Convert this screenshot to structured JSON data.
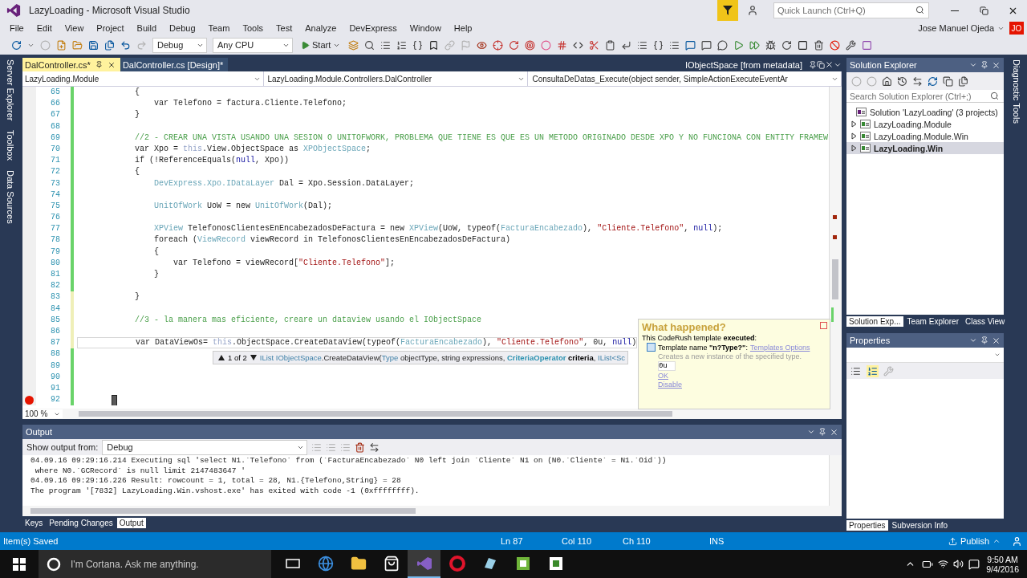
{
  "window": {
    "title": "LazyLoading - Microsoft Visual Studio",
    "quick_launch": {
      "placeholder": "Quick Launch (Ctrl+Q)"
    }
  },
  "menu": [
    "File",
    "Edit",
    "View",
    "Project",
    "Build",
    "Debug",
    "Team",
    "Tools",
    "Test",
    "Analyze",
    "DevExpress",
    "Window",
    "Help"
  ],
  "user": {
    "name": "Jose Manuel Ojeda",
    "initials": "JO"
  },
  "toolbar": {
    "configuration": "Debug",
    "platform": "Any CPU",
    "start": "Start"
  },
  "side_tabs_left": [
    "Server Explorer",
    "Toolbox",
    "Data Sources"
  ],
  "side_tabs_right": [
    "Diagnostic Tools"
  ],
  "editor": {
    "tabs": [
      {
        "label": "DalController.cs*",
        "selected": true
      },
      {
        "label": "DalController.cs [Design]*",
        "selected": false
      }
    ],
    "preview_tab": "IObjectSpace [from metadata]",
    "nav": [
      "LazyLoading.Module",
      "LazyLoading.Module.Controllers.DalController",
      "ConsultaDeDatas_Execute(object sender, SimpleActionExecuteEventAr"
    ],
    "lines": [
      {
        "number": "65",
        "saved": true,
        "breakpoint": false,
        "current": false,
        "marker": false,
        "segments": [
          {
            "text": "            {",
            "kind": "plain"
          }
        ]
      },
      {
        "number": "66",
        "saved": true,
        "breakpoint": false,
        "current": false,
        "marker": false,
        "segments": [
          {
            "text": "                var Telefono = factura.Cliente.Telefono;",
            "kind": "plain"
          }
        ]
      },
      {
        "number": "67",
        "saved": true,
        "breakpoint": false,
        "current": false,
        "marker": false,
        "segments": [
          {
            "text": "            }",
            "kind": "plain"
          }
        ]
      },
      {
        "number": "68",
        "saved": true,
        "breakpoint": false,
        "current": false,
        "marker": false
      },
      {
        "number": "69",
        "saved": true,
        "breakpoint": false,
        "current": false,
        "marker": false,
        "segments": [
          {
            "text": "            //2 - CREAR UNA VISTA USANDO UNA SESION O UNITOFWORK, PROBLEMA QUE TIENE ES QUE ES UN METODO ORIGINADO DESDE XPO Y NO FUNCIONA CON ENTITY FRAMEW",
            "kind": "comment"
          }
        ]
      },
      {
        "number": "70",
        "saved": true,
        "breakpoint": false,
        "current": false,
        "marker": false,
        "segments": [
          {
            "text": "            var Xpo = ",
            "kind": "plain"
          },
          {
            "text": "this",
            "kind": "this"
          },
          {
            "text": ".View.ObjectSpace as ",
            "kind": "plain"
          },
          {
            "text": "XPObjectSpace",
            "kind": "type"
          },
          {
            "text": ";",
            "kind": "plain"
          }
        ]
      },
      {
        "number": "71",
        "saved": true,
        "breakpoint": false,
        "current": false,
        "marker": false,
        "segments": [
          {
            "text": "            if (!ReferenceEquals(",
            "kind": "plain"
          },
          {
            "text": "null",
            "kind": "keyword"
          },
          {
            "text": ", Xpo))",
            "kind": "plain"
          }
        ]
      },
      {
        "number": "72",
        "saved": true,
        "breakpoint": false,
        "current": false,
        "marker": false,
        "segments": [
          {
            "text": "            {",
            "kind": "plain"
          }
        ]
      },
      {
        "number": "73",
        "saved": true,
        "breakpoint": false,
        "current": false,
        "marker": false,
        "segments": [
          {
            "text": "                DevExpress.Xpo.IDataLayer",
            "kind": "type"
          },
          {
            "text": " Dal = Xpo.Session.DataLayer;",
            "kind": "plain"
          }
        ]
      },
      {
        "number": "74",
        "saved": true,
        "breakpoint": false,
        "current": false,
        "marker": false
      },
      {
        "number": "75",
        "saved": true,
        "breakpoint": false,
        "current": false,
        "marker": false,
        "segments": [
          {
            "text": "                UnitOfWork",
            "kind": "type"
          },
          {
            "text": " UoW = new ",
            "kind": "plain"
          },
          {
            "text": "UnitOfWork",
            "kind": "type"
          },
          {
            "text": "(Dal);",
            "kind": "plain"
          }
        ]
      },
      {
        "number": "76",
        "saved": true,
        "breakpoint": false,
        "current": false,
        "marker": false
      },
      {
        "number": "77",
        "saved": true,
        "breakpoint": false,
        "current": false,
        "marker": false,
        "segments": [
          {
            "text": "                XPView",
            "kind": "type"
          },
          {
            "text": " TelefonosClientesEnEncabezadosDeFactura = new ",
            "kind": "plain"
          },
          {
            "text": "XPView",
            "kind": "type"
          },
          {
            "text": "(UoW, typeof(",
            "kind": "plain"
          },
          {
            "text": "FacturaEncabezado",
            "kind": "type"
          },
          {
            "text": "), ",
            "kind": "plain"
          },
          {
            "text": "\"Cliente.Telefono\"",
            "kind": "string"
          },
          {
            "text": ", ",
            "kind": "plain"
          },
          {
            "text": "null",
            "kind": "keyword"
          },
          {
            "text": ");",
            "kind": "plain"
          }
        ]
      },
      {
        "number": "78",
        "saved": true,
        "breakpoint": false,
        "current": false,
        "marker": false,
        "segments": [
          {
            "text": "                foreach (",
            "kind": "plain"
          },
          {
            "text": "ViewRecord",
            "kind": "type"
          },
          {
            "text": " viewRecord in TelefonosClientesEnEncabezadosDeFactura)",
            "kind": "plain"
          }
        ]
      },
      {
        "number": "79",
        "saved": true,
        "breakpoint": false,
        "current": false,
        "marker": false,
        "segments": [
          {
            "text": "                {",
            "kind": "plain"
          }
        ]
      },
      {
        "number": "80",
        "saved": true,
        "breakpoint": false,
        "current": false,
        "marker": false,
        "segments": [
          {
            "text": "                    var Telefono = viewRecord[",
            "kind": "plain"
          },
          {
            "text": "\"Cliente.Telefono\"",
            "kind": "string"
          },
          {
            "text": "];",
            "kind": "plain"
          }
        ]
      },
      {
        "number": "81",
        "saved": true,
        "breakpoint": false,
        "current": false,
        "marker": false,
        "segments": [
          {
            "text": "                }",
            "kind": "plain"
          }
        ]
      },
      {
        "number": "82",
        "saved": true,
        "breakpoint": false,
        "current": false,
        "marker": false
      },
      {
        "number": "83",
        "saved": false,
        "breakpoint": false,
        "current": false,
        "marker": false,
        "segments": [
          {
            "text": "            }",
            "kind": "plain"
          }
        ]
      },
      {
        "number": "84",
        "saved": false,
        "breakpoint": false,
        "current": false,
        "marker": false
      },
      {
        "number": "85",
        "saved": false,
        "breakpoint": false,
        "current": false,
        "marker": false,
        "segments": [
          {
            "text": "            //3 - la manera mas eficiente, creare un dataview usando el IObjectSpace",
            "kind": "comment"
          }
        ]
      },
      {
        "number": "86",
        "saved": false,
        "breakpoint": false,
        "current": false,
        "marker": false
      },
      {
        "number": "87",
        "saved": false,
        "breakpoint": false,
        "current": true,
        "marker": false,
        "segments": [
          {
            "text": "            var DataViewOs= ",
            "kind": "plain"
          },
          {
            "text": "this",
            "kind": "this"
          },
          {
            "text": ".ObjectSpace.CreateDataView(typeof(",
            "kind": "plain"
          },
          {
            "text": "FacturaEncabezado",
            "kind": "type"
          },
          {
            "text": "), ",
            "kind": "plain"
          },
          {
            "text": "\"Cliente.Telefono\"",
            "kind": "string"
          },
          {
            "text": ", 0u, ",
            "kind": "plain"
          },
          {
            "text": "null",
            "kind": "keyword"
          },
          {
            "text": ")",
            "kind": "plain"
          }
        ]
      },
      {
        "number": "88",
        "saved": true,
        "breakpoint": false,
        "current": false,
        "marker": false
      },
      {
        "number": "89",
        "saved": true,
        "breakpoint": false,
        "current": false,
        "marker": false
      },
      {
        "number": "90",
        "saved": true,
        "breakpoint": false,
        "current": false,
        "marker": false
      },
      {
        "number": "91",
        "saved": true,
        "breakpoint": false,
        "current": false,
        "marker": false
      },
      {
        "number": "92",
        "saved": true,
        "breakpoint": true,
        "current": false,
        "marker": true
      }
    ],
    "parameter_hint": {
      "counter": "1 of 2",
      "segments": [
        {
          "text": "IList IObjectSpace",
          "kind": "type"
        },
        {
          "text": ".CreateDataView(",
          "kind": "plain"
        },
        {
          "text": "Type",
          "kind": "type"
        },
        {
          "text": " objectType, string expressions, ",
          "kind": "plain"
        },
        {
          "text": "CriteriaOperator",
          "kind": "emphasis_type"
        },
        {
          "text": " criteria",
          "kind": "bold"
        },
        {
          "text": ", ",
          "kind": "plain"
        },
        {
          "text": "IList<Sc",
          "kind": "type"
        }
      ]
    },
    "zoom": "100 %"
  },
  "popup": {
    "title": "What happened?",
    "message": "This CodeRush template **executed**:",
    "template": "Template name **\"n?Type?\"**:",
    "options_link": "Templates Options",
    "description": "Creates a new instance of the specified type.",
    "value": "0u",
    "links": [
      "OK",
      "Disable"
    ]
  },
  "solution_explorer": {
    "title": "Solution Explorer",
    "search": {
      "placeholder": "Search Solution Explorer (Ctrl+;)"
    },
    "tree": [
      {
        "label": "Solution 'LazyLoading' (3 projects)",
        "kind": "solution",
        "selected": false,
        "children": [
          {
            "label": "LazyLoading.Module",
            "kind": "project",
            "expanded": false,
            "selected": false
          },
          {
            "label": "LazyLoading.Module.Win",
            "kind": "project",
            "expanded": false,
            "selected": false
          },
          {
            "label": "LazyLoading.Win",
            "kind": "project",
            "expanded": false,
            "selected": true
          }
        ]
      }
    ],
    "tabs": [
      {
        "label": "Solution Exp...",
        "selected": true
      },
      {
        "label": "Team Explorer",
        "selected": false
      },
      {
        "label": "Class View",
        "selected": false
      }
    ]
  },
  "properties": {
    "title": "Properties",
    "tabs": [
      {
        "label": "Properties",
        "selected": true
      },
      {
        "label": "Subversion Info",
        "selected": false
      }
    ]
  },
  "output": {
    "title": "Output",
    "source_label": "Show output from:",
    "source": "Debug",
    "lines": [
      "04.09.16 09:29:16.214 Executing sql 'select N1.`Telefono` from (`FacturaEncabezado` N0 left join `Cliente` N1 on (N0.`Cliente` = N1.`Oid`))",
      " where N0.`GCRecord` is null limit 2147483647 '",
      "04.09.16 09:29:16.226 Result: rowcount = 1, total = 28, N1.{Telefono,String} = 28",
      "The program '[7832] LazyLoading.Win.vshost.exe' has exited with code -1 (0xffffffff)."
    ],
    "tabs": [
      {
        "label": "Keys",
        "selected": false
      },
      {
        "label": "Pending Changes",
        "selected": false
      },
      {
        "label": "Output",
        "selected": true
      }
    ]
  },
  "status_bar": {
    "message": "Item(s) Saved",
    "line": "Ln 87",
    "column": "Col 110",
    "char": "Ch 110",
    "mode": "INS",
    "publish": "Publish"
  },
  "taskbar": {
    "search": {
      "placeholder": "I'm Cortana. Ask me anything."
    },
    "apps": [
      {
        "kind": "task_view",
        "active": false
      },
      {
        "kind": "browser",
        "active": false
      },
      {
        "kind": "folder",
        "active": false
      },
      {
        "kind": "store",
        "active": false
      },
      {
        "kind": "ide",
        "active": true
      },
      {
        "kind": "opera",
        "active": false
      },
      {
        "kind": "tool",
        "active": false
      },
      {
        "kind": "recorder",
        "active": false
      },
      {
        "kind": "editor",
        "active": false
      }
    ],
    "time": "9:50 AM",
    "date": "9/4/2016"
  }
}
